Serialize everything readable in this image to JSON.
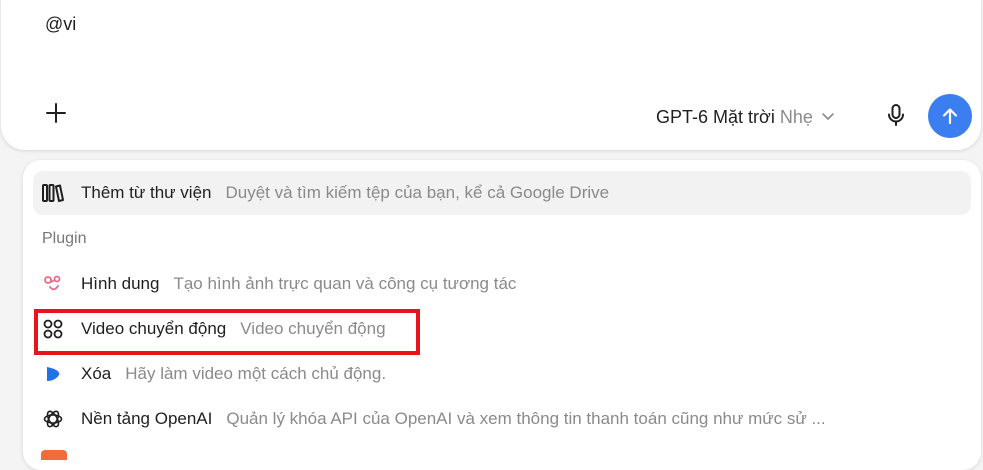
{
  "composer": {
    "input_text": "@vi",
    "model_name": "GPT-6 Mặt trời",
    "model_mode": "Nhẹ",
    "send_color": "#3b7ef0"
  },
  "popup": {
    "library": {
      "title": "Thêm từ thư viện",
      "description": "Duyệt và tìm kiếm tệp của bạn, kể cả Google Drive"
    },
    "section_label": "Plugin",
    "plugins": [
      {
        "title": "Hình dung",
        "description": "Tạo hình ảnh trực quan và công cụ tương tác",
        "icon": "visualize-icon"
      },
      {
        "title": "Video chuyển động",
        "description": "Video chuyển động",
        "icon": "motion-video-icon"
      },
      {
        "title": "Xóa",
        "description": "Hãy làm video một cách chủ động.",
        "icon": "blue-shape-icon"
      },
      {
        "title": "Nền tảng OpenAI",
        "description": "Quản lý khóa API của OpenAI và xem thông tin thanh toán cũng như mức sử ...",
        "icon": "openai-icon"
      }
    ]
  },
  "annotation": {
    "highlight_color": "#e8141b"
  }
}
